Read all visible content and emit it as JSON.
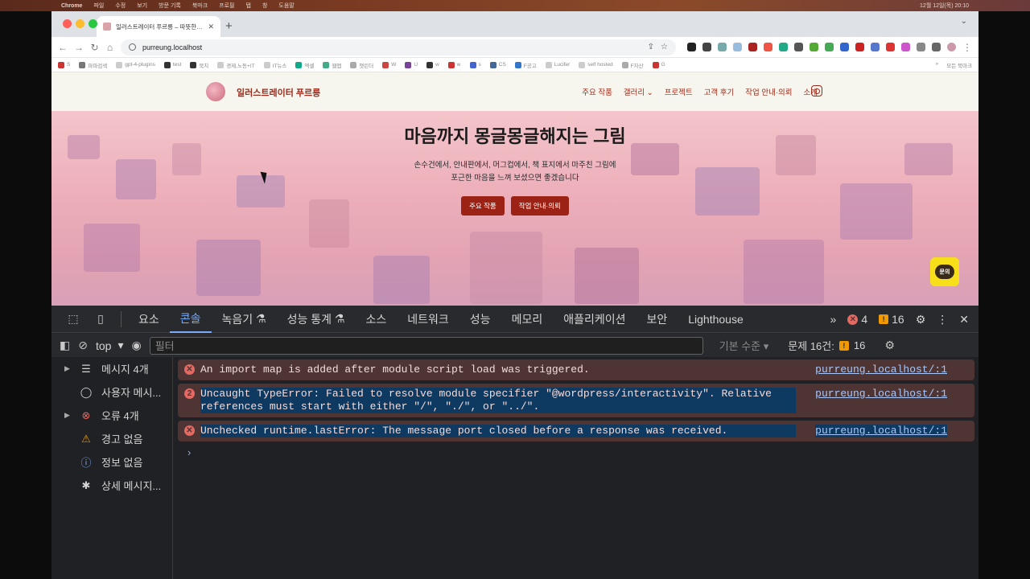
{
  "colors": {
    "accent": "#9c2215",
    "devtools_accent": "#7cacf8",
    "error": "#e46962",
    "warning": "#f29900"
  },
  "mac_menubar": {
    "items": [
      "Chrome",
      "파일",
      "수정",
      "보기",
      "방문 기록",
      "북마크",
      "프로필",
      "탭",
      "창",
      "도움말"
    ],
    "right": "12월 12일(목) 20:10"
  },
  "browser": {
    "tab_title": "일러스트레이터 푸르릉 – 따뜻한 감",
    "url": "purreung.localhost",
    "bookmarks": [
      "S",
      "파파검색",
      "gpt-4-plugins",
      "test",
      "북치",
      "경제,노동+IT",
      "IT뉴스",
      "엑셀",
      "웹맵",
      "챗린더",
      "W",
      "U",
      "w",
      "w",
      "s",
      "CS",
      "F공고",
      "Lucifer",
      "self hosted",
      "F자산",
      "G"
    ],
    "all_bookmarks": "모든 북마크"
  },
  "site": {
    "logo_text": "일러스트레이터 푸르릉",
    "nav": [
      "주요 작품",
      "갤러리",
      "프로젝트",
      "고객 후기",
      "작업 안내·의뢰",
      "소개"
    ],
    "hero": {
      "title": "마음까지 몽글몽글해지는 그림",
      "line1": "손수건에서, 안내판에서, 머그컵에서, 책 표지에서 마주친 그림에",
      "line2": "포근한 마음을 느껴 보셨으면 좋겠습니다",
      "btn1": "주요 작품",
      "btn2": "작업 안내·의뢰"
    },
    "chat_label": "문의"
  },
  "devtools": {
    "tabs": [
      "요소",
      "콘솔",
      "녹음기",
      "성능 통계",
      "소스",
      "네트워크",
      "성능",
      "메모리",
      "애플리케이션",
      "보안",
      "Lighthouse"
    ],
    "active_tab": "콘솔",
    "error_count": "4",
    "warning_count": "16",
    "context": "top",
    "filter_placeholder": "필터",
    "level": "기본 수준",
    "issues_label": "문제 16건:",
    "issues_count": "16",
    "sidebar": [
      "메시지 4개",
      "사용자 메시...",
      "오류 4개",
      "경고 없음",
      "정보 없음",
      "상세 메시지..."
    ],
    "messages": [
      {
        "badge": "",
        "text": "An import map is added after module script load was triggered.",
        "src": "purreung.localhost/:1"
      },
      {
        "badge": "2",
        "text": "Uncaught TypeError: Failed to resolve module specifier \"@wordpress/interactivity\". Relative references must start with either \"/\", \"./\", or \"../\".",
        "src": "purreung.localhost/:1"
      },
      {
        "badge": "",
        "text": "Unchecked runtime.lastError: The message port closed before a response was received.",
        "src": "purreung.localhost/:1"
      }
    ]
  }
}
